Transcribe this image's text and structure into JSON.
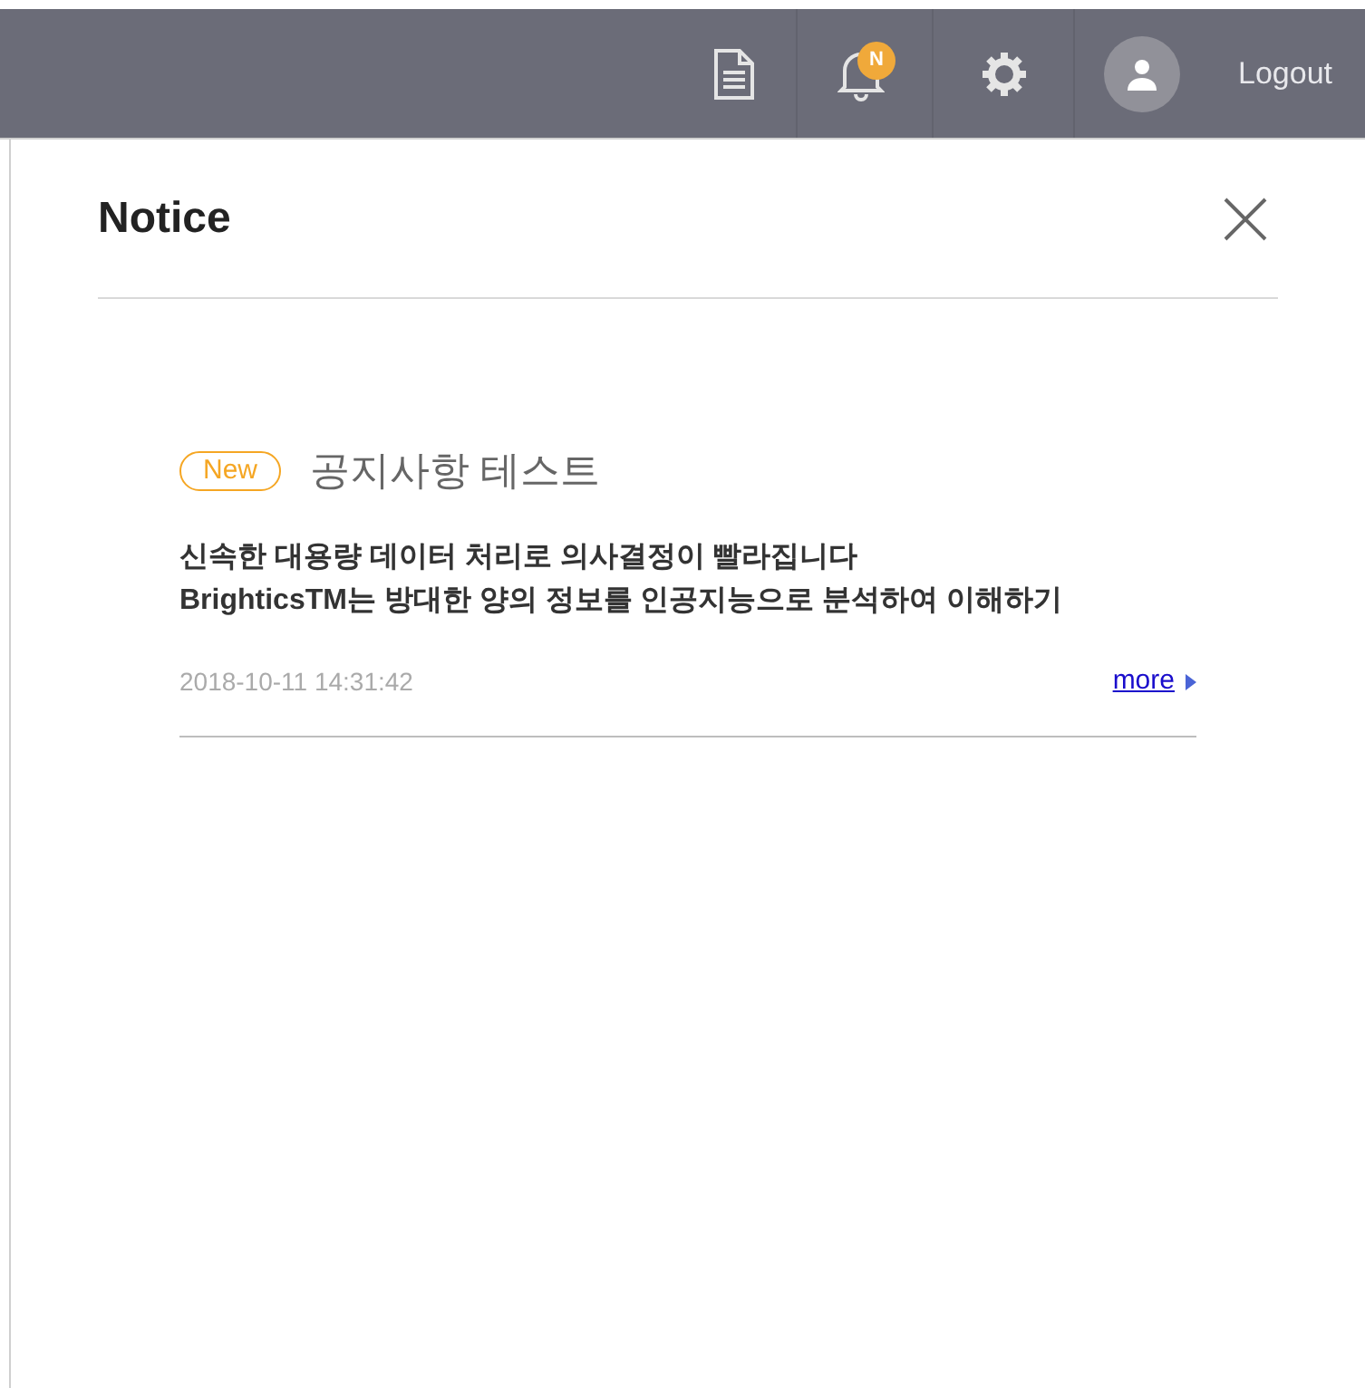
{
  "header": {
    "notification_badge": "N",
    "logout": "Logout"
  },
  "panel": {
    "title": "Notice"
  },
  "notices": [
    {
      "is_new": true,
      "badge": "New",
      "title": "공지사항 테스트",
      "body": [
        "신속한 대용량 데이터 처리로 의사결정이 빨라집니다",
        "BrighticsTM는 방대한 양의 정보를 인공지능으로 분석하여 이해하기"
      ],
      "date": "2018-10-11 14:31:42",
      "more": "more"
    }
  ]
}
